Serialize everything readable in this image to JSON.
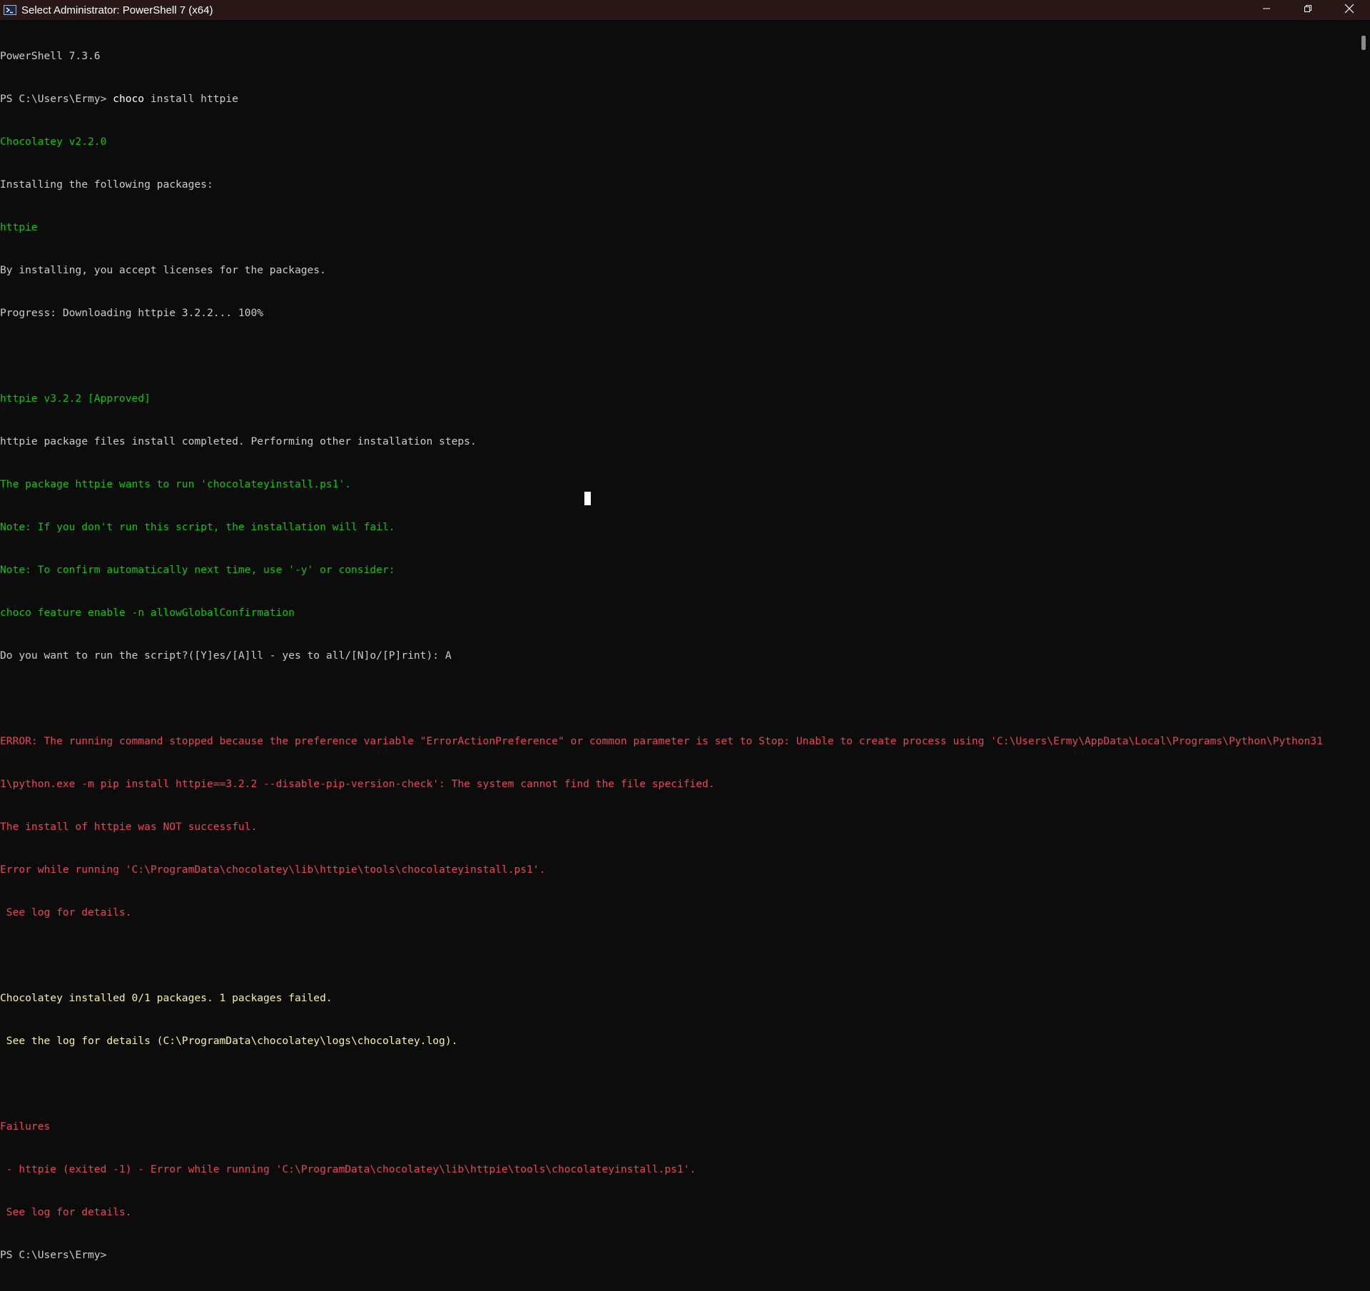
{
  "window": {
    "title": "Select Administrator: PowerShell 7 (x64)",
    "icons": {
      "app": "powershell-icon",
      "minimize": "minimize-icon",
      "maximize": "restore-icon",
      "close": "close-icon"
    },
    "colors": {
      "background": "#0c0c0c",
      "titlebar": "#2a1818",
      "text": "#cccccc",
      "green": "#16c60c",
      "red": "#e74856",
      "yellow": "#f9f1a5"
    }
  },
  "terminal": {
    "lines": [
      {
        "text": "PowerShell 7.3.6",
        "color": "default"
      },
      {
        "prompt": "PS C:\\Users\\Ermy> ",
        "command": "choco",
        "args": " install httpie",
        "color": "default"
      },
      {
        "text": "Chocolatey v2.2.0",
        "color": "green"
      },
      {
        "text": "Installing the following packages:",
        "color": "default"
      },
      {
        "text": "httpie",
        "color": "green"
      },
      {
        "text": "By installing, you accept licenses for the packages.",
        "color": "default"
      },
      {
        "text": "Progress: Downloading httpie 3.2.2... 100%",
        "color": "default"
      },
      {
        "text": "",
        "color": "default"
      },
      {
        "text": "httpie v3.2.2 [Approved]",
        "color": "green"
      },
      {
        "text": "httpie package files install completed. Performing other installation steps.",
        "color": "default"
      },
      {
        "text": "The package httpie wants to run 'chocolateyinstall.ps1'.",
        "color": "green"
      },
      {
        "text": "Note: If you don't run this script, the installation will fail.",
        "color": "green"
      },
      {
        "text": "Note: To confirm automatically next time, use '-y' or consider:",
        "color": "green"
      },
      {
        "text": "choco feature enable -n allowGlobalConfirmation",
        "color": "green"
      },
      {
        "text": "Do you want to run the script?([Y]es/[A]ll - yes to all/[N]o/[P]rint): A",
        "color": "default"
      },
      {
        "text": "",
        "color": "default"
      },
      {
        "text": "ERROR: The running command stopped because the preference variable \"ErrorActionPreference\" or common parameter is set to Stop: Unable to create process using 'C:\\Users\\Ermy\\AppData\\Local\\Programs\\Python\\Python31",
        "color": "red"
      },
      {
        "text": "1\\python.exe -m pip install httpie==3.2.2 --disable-pip-version-check': The system cannot find the file specified.",
        "color": "red"
      },
      {
        "text": "The install of httpie was NOT successful.",
        "color": "red"
      },
      {
        "text": "Error while running 'C:\\ProgramData\\chocolatey\\lib\\httpie\\tools\\chocolateyinstall.ps1'.",
        "color": "red"
      },
      {
        "text": " See log for details.",
        "color": "red"
      },
      {
        "text": "",
        "color": "default"
      },
      {
        "text": "Chocolatey installed 0/1 packages. 1 packages failed.",
        "color": "yellow"
      },
      {
        "text": " See the log for details (C:\\ProgramData\\chocolatey\\logs\\chocolatey.log).",
        "color": "yellow"
      },
      {
        "text": "",
        "color": "default"
      },
      {
        "text": "Failures",
        "color": "red"
      },
      {
        "text": " - httpie (exited -1) - Error while running 'C:\\ProgramData\\chocolatey\\lib\\httpie\\tools\\chocolateyinstall.ps1'.",
        "color": "red"
      },
      {
        "text": " See log for details.",
        "color": "red"
      },
      {
        "text": "PS C:\\Users\\Ermy> ",
        "color": "default"
      }
    ]
  }
}
